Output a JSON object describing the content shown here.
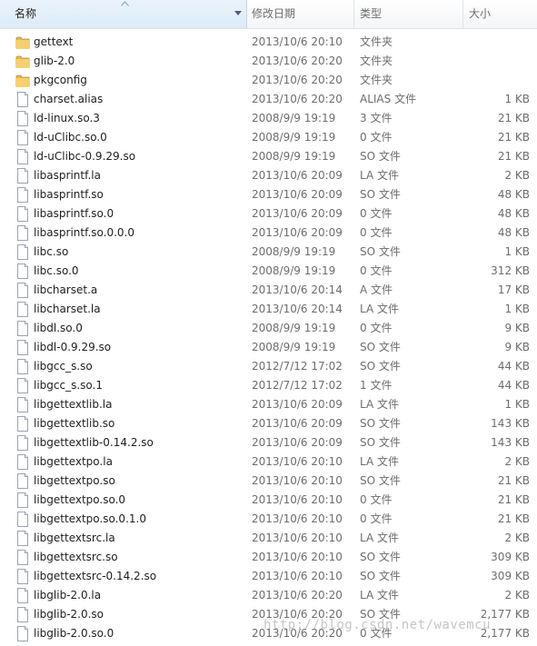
{
  "header": {
    "col_name": "名称",
    "col_date": "修改日期",
    "col_type": "类型",
    "col_size": "大小"
  },
  "files": [
    {
      "name": "gettext",
      "date": "2013/10/6 20:10",
      "type": "文件夹",
      "size": "",
      "kind": "folder"
    },
    {
      "name": "glib-2.0",
      "date": "2013/10/6 20:20",
      "type": "文件夹",
      "size": "",
      "kind": "folder"
    },
    {
      "name": "pkgconfig",
      "date": "2013/10/6 20:20",
      "type": "文件夹",
      "size": "",
      "kind": "folder"
    },
    {
      "name": "charset.alias",
      "date": "2013/10/6 20:20",
      "type": "ALIAS 文件",
      "size": "1 KB",
      "kind": "file"
    },
    {
      "name": "ld-linux.so.3",
      "date": "2008/9/9 19:19",
      "type": "3 文件",
      "size": "21 KB",
      "kind": "file"
    },
    {
      "name": "ld-uClibc.so.0",
      "date": "2008/9/9 19:19",
      "type": "0 文件",
      "size": "21 KB",
      "kind": "file"
    },
    {
      "name": "ld-uClibc-0.9.29.so",
      "date": "2008/9/9 19:19",
      "type": "SO 文件",
      "size": "21 KB",
      "kind": "file"
    },
    {
      "name": "libasprintf.la",
      "date": "2013/10/6 20:09",
      "type": "LA 文件",
      "size": "2 KB",
      "kind": "file"
    },
    {
      "name": "libasprintf.so",
      "date": "2013/10/6 20:09",
      "type": "SO 文件",
      "size": "48 KB",
      "kind": "file"
    },
    {
      "name": "libasprintf.so.0",
      "date": "2013/10/6 20:09",
      "type": "0 文件",
      "size": "48 KB",
      "kind": "file"
    },
    {
      "name": "libasprintf.so.0.0.0",
      "date": "2013/10/6 20:09",
      "type": "0 文件",
      "size": "48 KB",
      "kind": "file"
    },
    {
      "name": "libc.so",
      "date": "2008/9/9 19:19",
      "type": "SO 文件",
      "size": "1 KB",
      "kind": "file"
    },
    {
      "name": "libc.so.0",
      "date": "2008/9/9 19:19",
      "type": "0 文件",
      "size": "312 KB",
      "kind": "file"
    },
    {
      "name": "libcharset.a",
      "date": "2013/10/6 20:14",
      "type": "A 文件",
      "size": "17 KB",
      "kind": "file"
    },
    {
      "name": "libcharset.la",
      "date": "2013/10/6 20:14",
      "type": "LA 文件",
      "size": "1 KB",
      "kind": "file"
    },
    {
      "name": "libdl.so.0",
      "date": "2008/9/9 19:19",
      "type": "0 文件",
      "size": "9 KB",
      "kind": "file"
    },
    {
      "name": "libdl-0.9.29.so",
      "date": "2008/9/9 19:19",
      "type": "SO 文件",
      "size": "9 KB",
      "kind": "file"
    },
    {
      "name": "libgcc_s.so",
      "date": "2012/7/12 17:02",
      "type": "SO 文件",
      "size": "44 KB",
      "kind": "file"
    },
    {
      "name": "libgcc_s.so.1",
      "date": "2012/7/12 17:02",
      "type": "1 文件",
      "size": "44 KB",
      "kind": "file"
    },
    {
      "name": "libgettextlib.la",
      "date": "2013/10/6 20:09",
      "type": "LA 文件",
      "size": "1 KB",
      "kind": "file"
    },
    {
      "name": "libgettextlib.so",
      "date": "2013/10/6 20:09",
      "type": "SO 文件",
      "size": "143 KB",
      "kind": "file"
    },
    {
      "name": "libgettextlib-0.14.2.so",
      "date": "2013/10/6 20:09",
      "type": "SO 文件",
      "size": "143 KB",
      "kind": "file"
    },
    {
      "name": "libgettextpo.la",
      "date": "2013/10/6 20:10",
      "type": "LA 文件",
      "size": "2 KB",
      "kind": "file"
    },
    {
      "name": "libgettextpo.so",
      "date": "2013/10/6 20:10",
      "type": "SO 文件",
      "size": "21 KB",
      "kind": "file"
    },
    {
      "name": "libgettextpo.so.0",
      "date": "2013/10/6 20:10",
      "type": "0 文件",
      "size": "21 KB",
      "kind": "file"
    },
    {
      "name": "libgettextpo.so.0.1.0",
      "date": "2013/10/6 20:10",
      "type": "0 文件",
      "size": "21 KB",
      "kind": "file"
    },
    {
      "name": "libgettextsrc.la",
      "date": "2013/10/6 20:10",
      "type": "LA 文件",
      "size": "2 KB",
      "kind": "file"
    },
    {
      "name": "libgettextsrc.so",
      "date": "2013/10/6 20:10",
      "type": "SO 文件",
      "size": "309 KB",
      "kind": "file"
    },
    {
      "name": "libgettextsrc-0.14.2.so",
      "date": "2013/10/6 20:10",
      "type": "SO 文件",
      "size": "309 KB",
      "kind": "file"
    },
    {
      "name": "libglib-2.0.la",
      "date": "2013/10/6 20:20",
      "type": "LA 文件",
      "size": "2 KB",
      "kind": "file"
    },
    {
      "name": "libglib-2.0.so",
      "date": "2013/10/6 20:20",
      "type": "SO 文件",
      "size": "2,177 KB",
      "kind": "file"
    },
    {
      "name": "libglib-2.0.so.0",
      "date": "2013/10/6 20:20",
      "type": "0 文件",
      "size": "2,177 KB",
      "kind": "file"
    }
  ],
  "watermark": "http://blog.csdn.net/wavemcu",
  "colors": {
    "header_text": "#4c607a",
    "folder_yellow": "#e8b84a",
    "detail_text": "#6d6d6d"
  }
}
